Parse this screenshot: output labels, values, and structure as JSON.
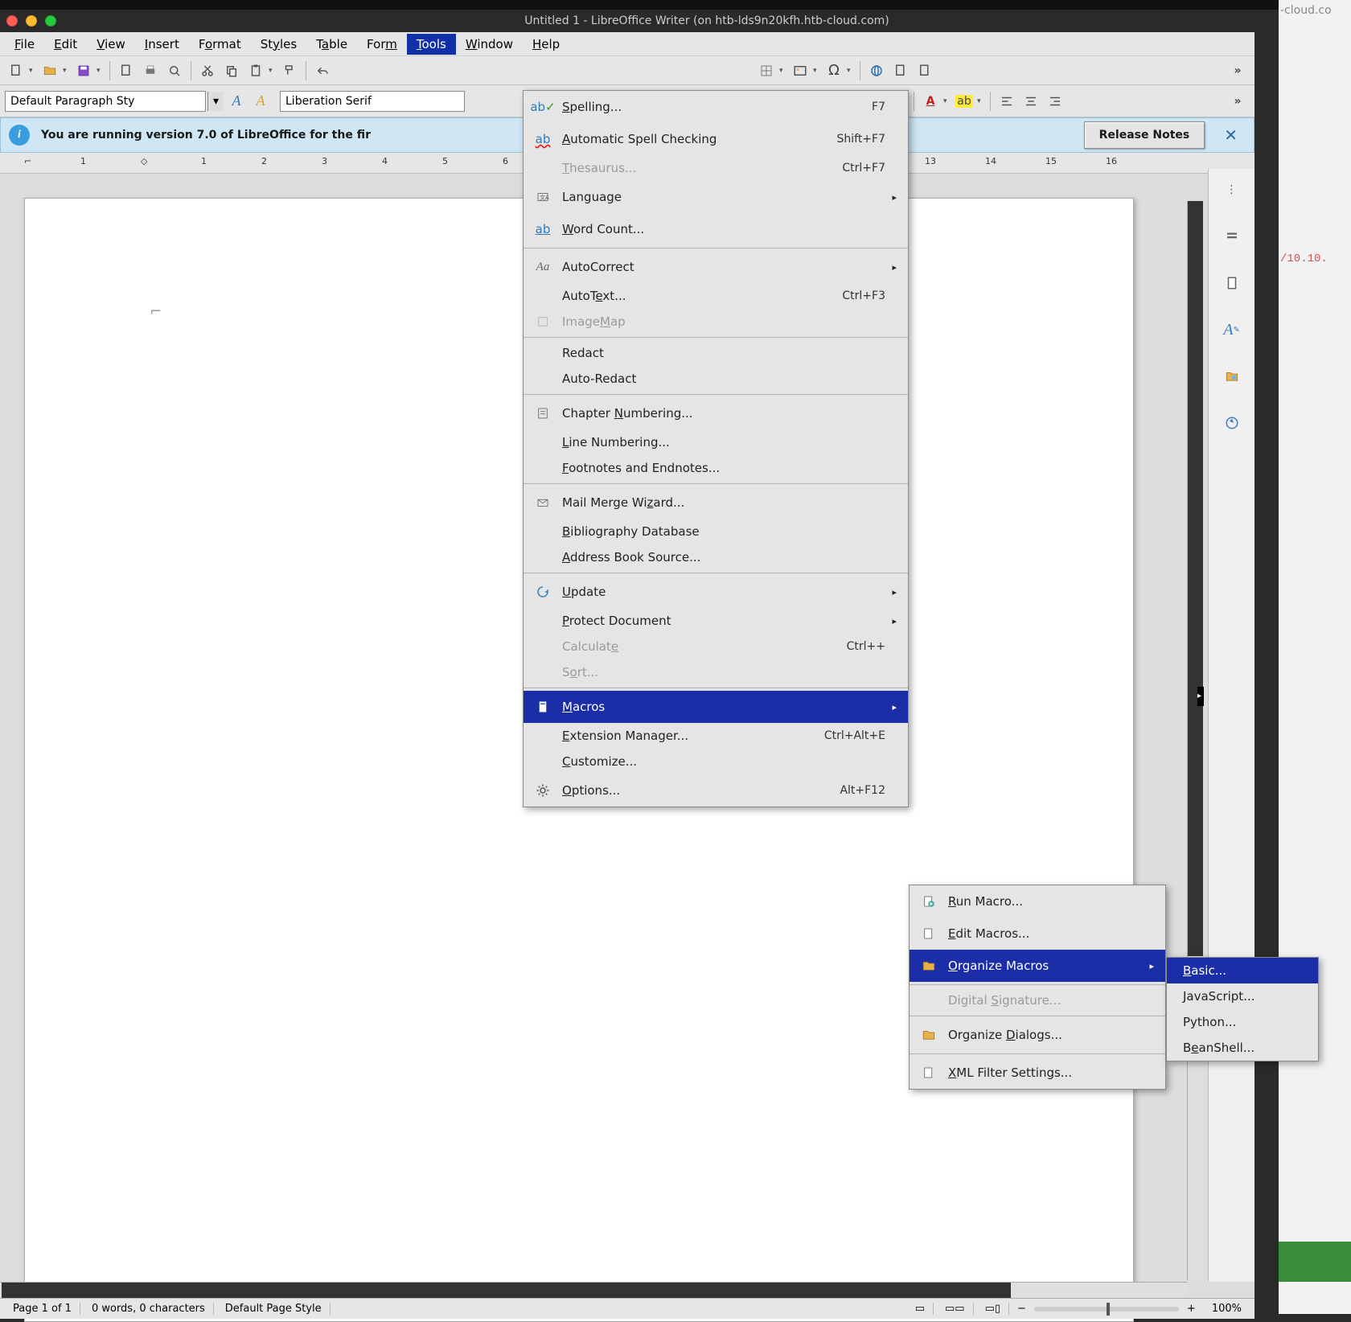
{
  "titlebar": {
    "title": "Untitled 1 - LibreOffice Writer (on htb-lds9n20kfh.htb-cloud.com)"
  },
  "bg": {
    "hostsuffix": "-cloud.co",
    "ip": "/10.10."
  },
  "menubar": {
    "file": "File",
    "edit": "Edit",
    "view": "View",
    "insert": "Insert",
    "format": "Format",
    "styles": "Styles",
    "table": "Table",
    "form": "Form",
    "tools": "Tools",
    "window": "Window",
    "help": "Help"
  },
  "toolbar": {
    "style_select": "Default Paragraph Sty",
    "font_select": "Liberation Serif"
  },
  "infobar": {
    "text": "You are running version 7.0 of LibreOffice for the fir",
    "release": "Release Notes"
  },
  "ruler": {
    "neg1": "1",
    "n1": "1",
    "n2": "2",
    "n3": "3",
    "n4": "4",
    "n5": "5",
    "n6": "6",
    "n13": "13",
    "n14": "14",
    "n15": "15",
    "n16": "16"
  },
  "sidebar": {},
  "statusbar": {
    "page": "Page 1 of 1",
    "words": "0 words, 0 characters",
    "style": "Default Page Style",
    "zoom": "100%"
  },
  "tools_menu": {
    "spelling": {
      "label": "Spelling...",
      "accel": "F7"
    },
    "autospell": {
      "label": "Automatic Spell Checking",
      "accel": "Shift+F7"
    },
    "thesaurus": {
      "label": "Thesaurus...",
      "accel": "Ctrl+F7"
    },
    "language": {
      "label": "Language"
    },
    "wordcount": {
      "label": "Word Count..."
    },
    "autocorrect": {
      "label": "AutoCorrect"
    },
    "autotext": {
      "label": "AutoText...",
      "accel": "Ctrl+F3"
    },
    "imagemap": {
      "label": "ImageMap"
    },
    "redact": {
      "label": "Redact"
    },
    "autoredact": {
      "label": "Auto-Redact"
    },
    "chapter": {
      "label": "Chapter Numbering..."
    },
    "linenum": {
      "label": "Line Numbering..."
    },
    "footnotes": {
      "label": "Footnotes and Endnotes..."
    },
    "mailmerge": {
      "label": "Mail Merge Wizard..."
    },
    "biblio": {
      "label": "Bibliography Database"
    },
    "addrbook": {
      "label": "Address Book Source..."
    },
    "update": {
      "label": "Update"
    },
    "protect": {
      "label": "Protect Document"
    },
    "calculate": {
      "label": "Calculate",
      "accel": "Ctrl++"
    },
    "sort": {
      "label": "Sort..."
    },
    "macros": {
      "label": "Macros"
    },
    "extmgr": {
      "label": "Extension Manager...",
      "accel": "Ctrl+Alt+E"
    },
    "customize": {
      "label": "Customize..."
    },
    "options": {
      "label": "Options...",
      "accel": "Alt+F12"
    }
  },
  "macros_sub": {
    "run": {
      "label": "Run Macro..."
    },
    "edit": {
      "label": "Edit Macros..."
    },
    "organize": {
      "label": "Organize Macros"
    },
    "digsig": {
      "label": "Digital Signature..."
    },
    "dialogs": {
      "label": "Organize Dialogs..."
    },
    "xml": {
      "label": "XML Filter Settings..."
    }
  },
  "organize_sub": {
    "basic": {
      "label": "Basic..."
    },
    "js": {
      "label": "JavaScript..."
    },
    "python": {
      "label": "Python..."
    },
    "bean": {
      "label": "BeanShell..."
    }
  }
}
